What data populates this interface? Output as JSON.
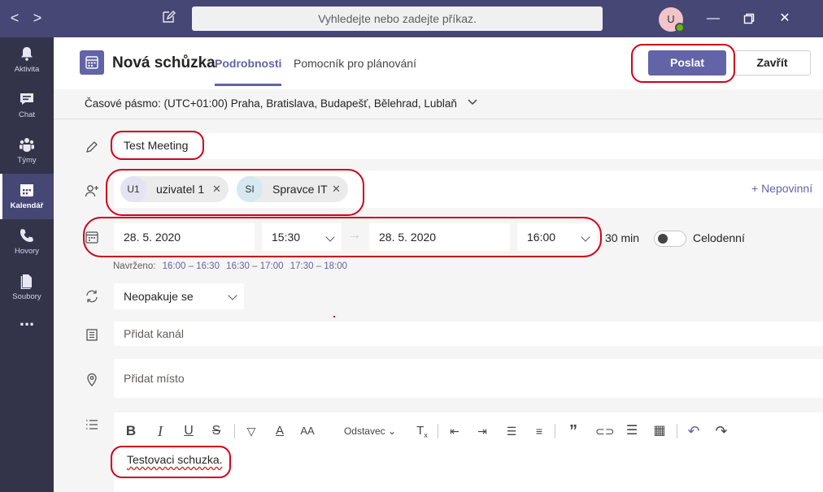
{
  "topbar": {
    "back": "<",
    "forward": ">",
    "search_placeholder": "Vyhledejte nebo zadejte příkaz.",
    "avatar_initial": "U"
  },
  "rail": [
    {
      "label": "Aktivita",
      "icon": "bell-icon"
    },
    {
      "label": "Chat",
      "icon": "chat-icon"
    },
    {
      "label": "Týmy",
      "icon": "teams-icon"
    },
    {
      "label": "Kalendář",
      "icon": "calendar-icon",
      "active": true
    },
    {
      "label": "Hovory",
      "icon": "phone-icon"
    },
    {
      "label": "Soubory",
      "icon": "file-icon"
    },
    {
      "label": "...",
      "icon": "more-icon"
    }
  ],
  "header": {
    "title": "Nová schůzka",
    "tabs": [
      "Podrobnosti",
      "Pomocník pro plánování"
    ],
    "send_label": "Poslat",
    "close_label": "Zavřít"
  },
  "timezone": "Časové pásmo: (UTC+01:00) Praha, Bratislava, Budapešť, Bělehrad, Lublaň",
  "form": {
    "title_value": "Test Meeting",
    "attendees": [
      {
        "initials": "U1",
        "name": "uzivatel 1",
        "color": "#e3e3f1"
      },
      {
        "initials": "SI",
        "name": "Spravce IT",
        "color": "#d6e8f0"
      }
    ],
    "optional_label": "+ Nepovinní",
    "start_date": "28. 5. 2020",
    "start_time": "15:30",
    "end_date": "28. 5. 2020",
    "end_time": "16:00",
    "duration": "30 min",
    "allday_label": "Celodenní",
    "suggested_label": "Navrženo:",
    "suggested_slots": [
      "16:00 – 16:30",
      "16:30 – 17:00",
      "17:30 – 18:00"
    ],
    "repeat_value": "Neopakuje se",
    "channel_placeholder": "Přidat kanál",
    "location_placeholder": "Přidat místo",
    "paragraph_label": "Odstavec",
    "body_text": "Testovaci schuzka."
  },
  "colors": {
    "accent": "#6264a7",
    "rail_bg": "#33344a",
    "titlebar_bg": "#464775",
    "annotation": "#d0021b"
  }
}
